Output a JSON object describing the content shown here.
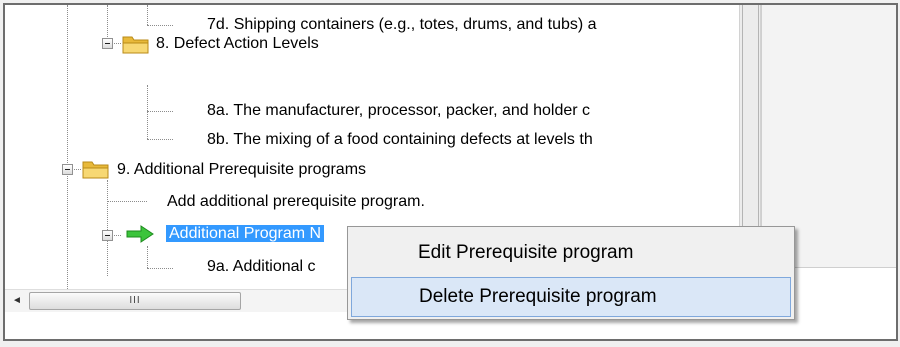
{
  "tree": {
    "items": [
      {
        "label": "7d. Shipping containers (e.g., totes, drums, and tubs) a"
      },
      {
        "label": "8. Defect Action Levels"
      },
      {
        "label": "8a. The manufacturer, processor, packer, and holder c"
      },
      {
        "label": "8b. The mixing of a food containing defects at levels th"
      },
      {
        "label": "9. Additional Prerequisite programs"
      },
      {
        "label": "Add additional prerequisite program."
      },
      {
        "label": "Additional Program N"
      },
      {
        "label": "9a. Additional c"
      }
    ]
  },
  "scrollbar": {
    "thumb_grip": "III",
    "left_arrow": "◄"
  },
  "context_menu": {
    "items": [
      {
        "label": "Edit Prerequisite program"
      },
      {
        "label": "Delete Prerequisite program"
      }
    ]
  },
  "colors": {
    "selection": "#3399ff",
    "menu_hover": "#dae7f7",
    "folder": "#f2c94c",
    "arrow": "#3cc43c"
  },
  "icons": {
    "folder": "folder-icon",
    "arrow": "green-arrow-icon",
    "expander": "collapse-icon"
  }
}
